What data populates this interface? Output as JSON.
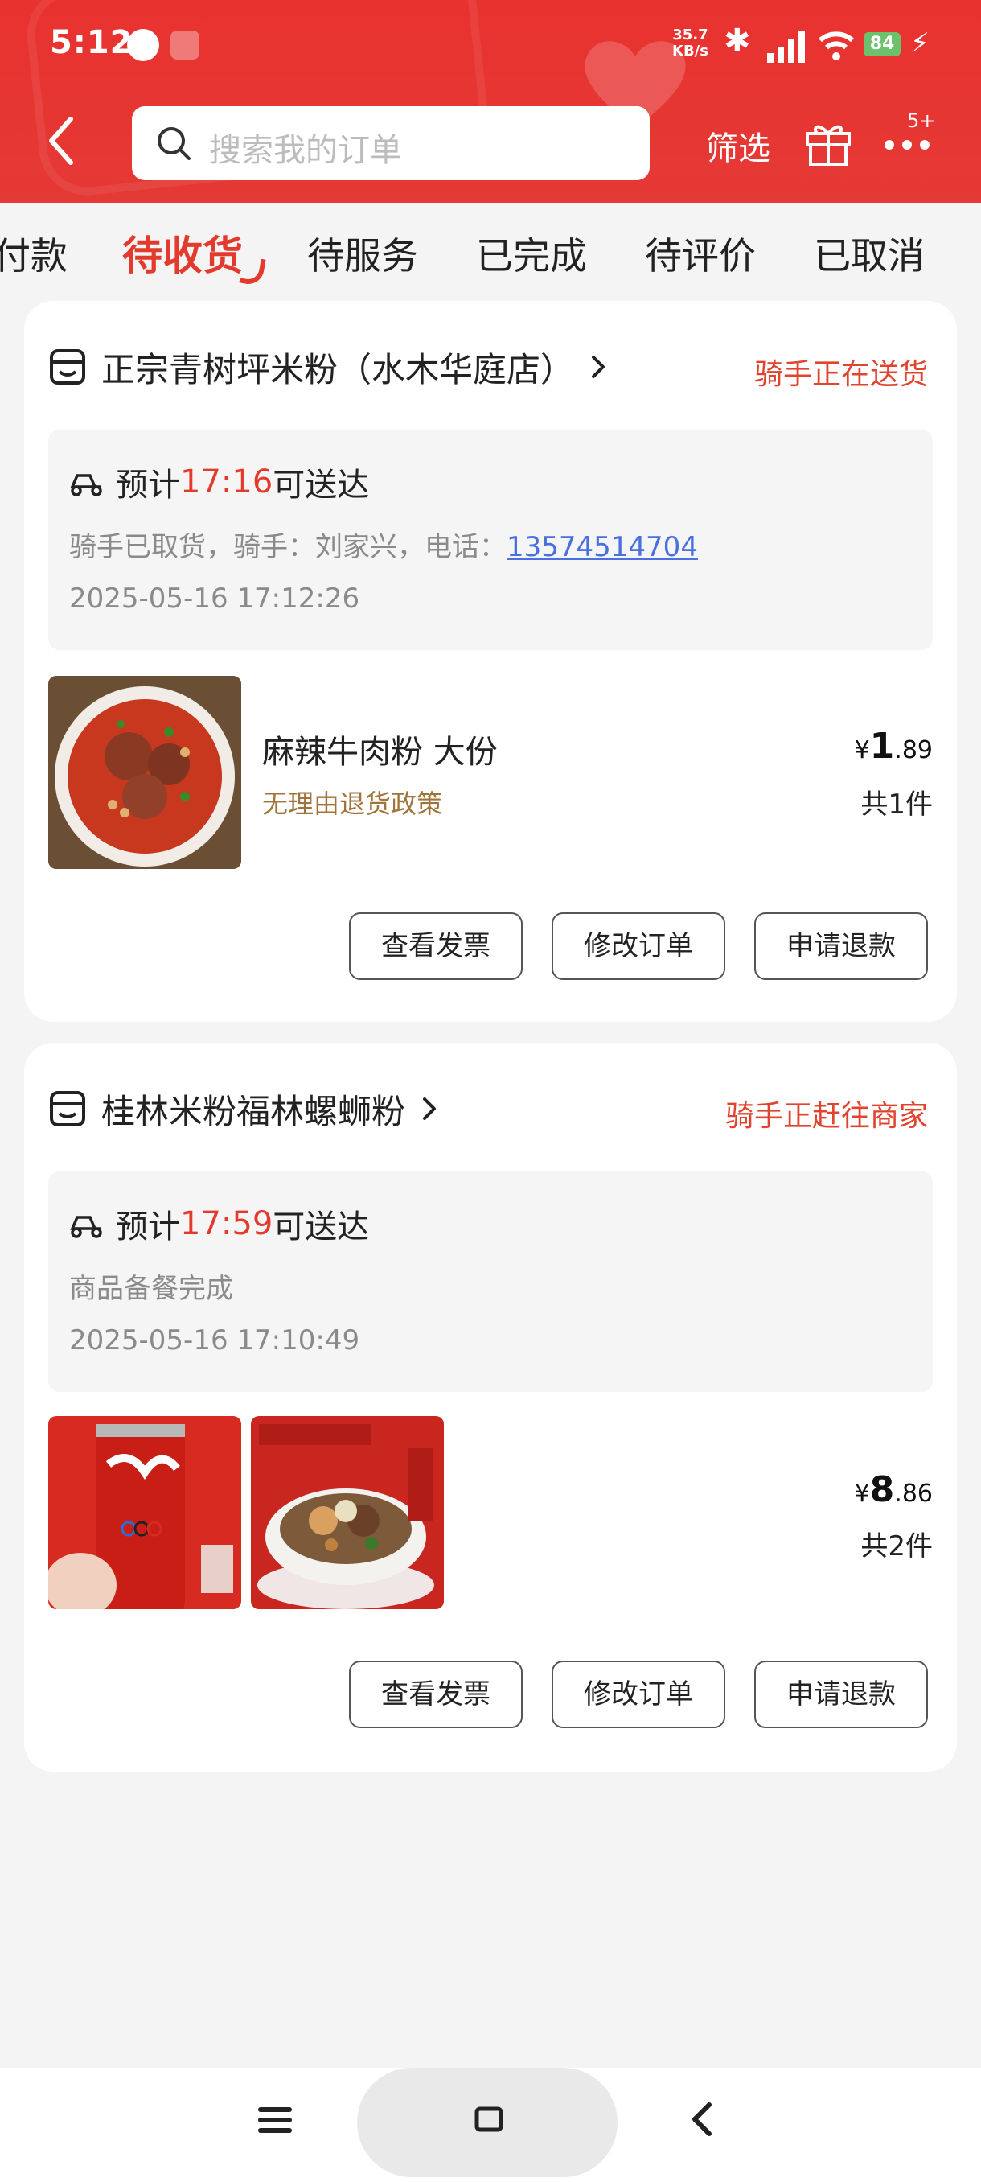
{
  "status_bar": {
    "time": "5:12",
    "net_speed_value": "35.7",
    "net_speed_unit": "KB/s",
    "battery": "84"
  },
  "header": {
    "search_placeholder": "搜索我的订单",
    "filter_label": "筛选",
    "more_badge": "5+"
  },
  "tabs": [
    {
      "label": "付款"
    },
    {
      "label": "待收货"
    },
    {
      "label": "待服务"
    },
    {
      "label": "已完成"
    },
    {
      "label": "待评价"
    },
    {
      "label": "已取消"
    }
  ],
  "orders": [
    {
      "shop": "正宗青树坪米粉（水木华庭店）",
      "status": "骑手正在送货",
      "eta_prefix": "预计",
      "eta_time": "17:16",
      "eta_suffix": "可送达",
      "rider_info": "骑手已取货，骑手：刘家兴，电话：",
      "rider_phone": "13574514704",
      "timestamp": "2025-05-16 17:12:26",
      "product_name": "麻辣牛肉粉 大份",
      "product_tag": "无理由退货政策",
      "price_symbol": "¥",
      "price_int": "1",
      "price_dec": ".89",
      "qty": "共1件",
      "buttons": [
        "查看发票",
        "修改订单",
        "申请退款"
      ]
    },
    {
      "shop": "桂林米粉福林螺蛳粉",
      "status": "骑手正赶往商家",
      "eta_prefix": "预计",
      "eta_time": "17:59",
      "eta_suffix": "可送达",
      "note": "商品备餐完成",
      "timestamp": "2025-05-16 17:10:49",
      "price_symbol": "¥",
      "price_int": "8",
      "price_dec": ".86",
      "qty": "共2件",
      "buttons": [
        "查看发票",
        "修改订单",
        "申请退款"
      ]
    }
  ],
  "colors": {
    "brand_red": "#e53935",
    "accent_red": "#e33a2d",
    "link_blue": "#4a6fe0",
    "tag_brown": "#a07338"
  }
}
